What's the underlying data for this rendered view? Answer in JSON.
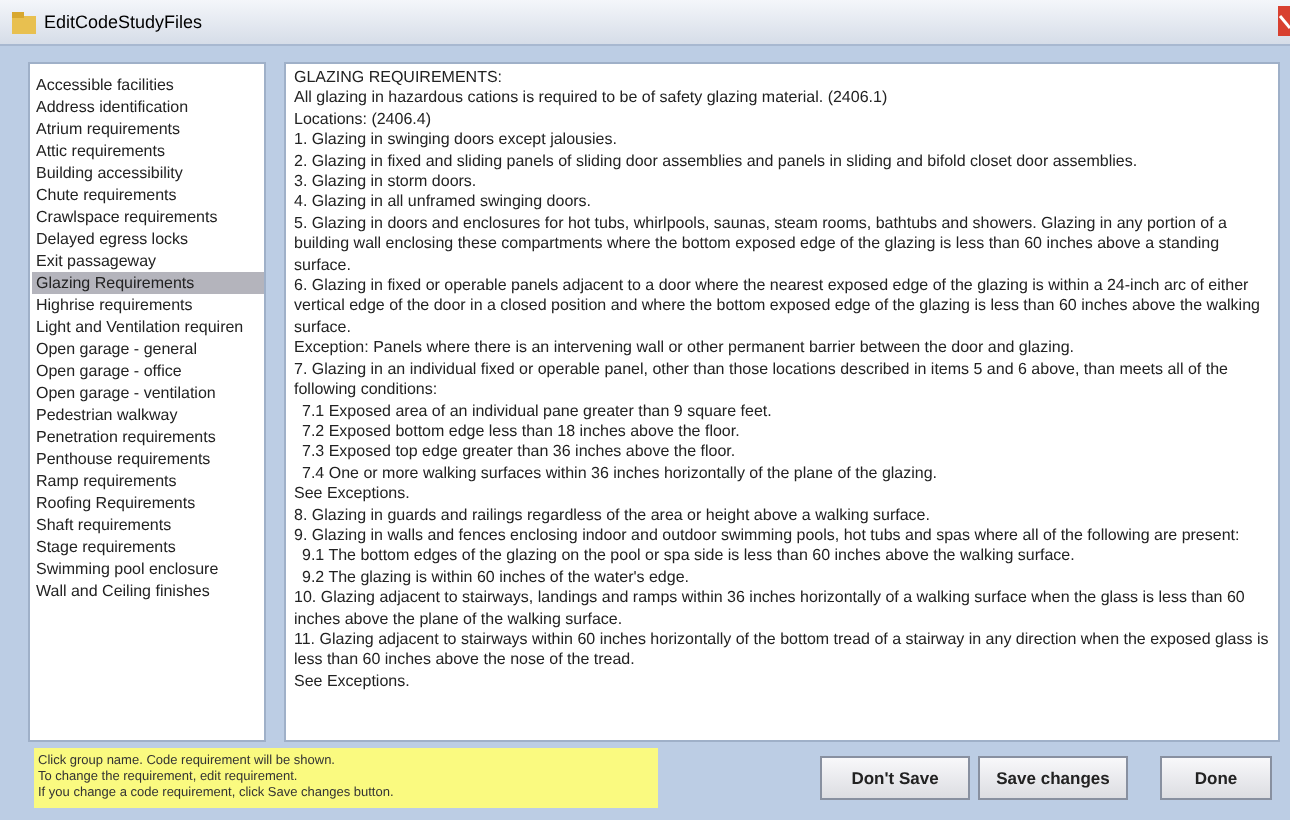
{
  "window": {
    "title": "EditCodeStudyFiles"
  },
  "groups": [
    {
      "label": "Accessible facilities",
      "selected": false
    },
    {
      "label": "Address identification",
      "selected": false
    },
    {
      "label": "Atrium requirements",
      "selected": false
    },
    {
      "label": "Attic requirements",
      "selected": false
    },
    {
      "label": "Building accessibility",
      "selected": false
    },
    {
      "label": "Chute requirements",
      "selected": false
    },
    {
      "label": "Crawlspace requirements",
      "selected": false
    },
    {
      "label": "Delayed egress locks",
      "selected": false
    },
    {
      "label": "Exit passageway",
      "selected": false
    },
    {
      "label": "Glazing Requirements",
      "selected": true
    },
    {
      "label": "Highrise requirements",
      "selected": false
    },
    {
      "label": "Light and Ventilation requiren",
      "selected": false
    },
    {
      "label": "Open garage - general",
      "selected": false
    },
    {
      "label": "Open garage - office",
      "selected": false
    },
    {
      "label": "Open garage - ventilation",
      "selected": false
    },
    {
      "label": "Pedestrian walkway",
      "selected": false
    },
    {
      "label": "Penetration requirements",
      "selected": false
    },
    {
      "label": "Penthouse requirements",
      "selected": false
    },
    {
      "label": "Ramp requirements",
      "selected": false
    },
    {
      "label": "Roofing Requirements",
      "selected": false
    },
    {
      "label": "Shaft requirements",
      "selected": false
    },
    {
      "label": "Stage requirements",
      "selected": false
    },
    {
      "label": "Swimming pool enclosure",
      "selected": false
    },
    {
      "label": "Wall and Ceiling finishes",
      "selected": false
    }
  ],
  "requirement": [
    {
      "kind": "line",
      "text": "GLAZING REQUIREMENTS:"
    },
    {
      "kind": "line",
      "text": "All glazing in hazardous cations is required to be of safety glazing material. (2406.1)"
    },
    {
      "kind": "line",
      "text": "Locations: (2406.4)"
    },
    {
      "kind": "line",
      "text": "1. Glazing in swinging doors except jalousies."
    },
    {
      "kind": "line",
      "text": "2. Glazing in fixed and sliding panels of sliding door assemblies and panels in sliding and bifold closet door assemblies."
    },
    {
      "kind": "line",
      "text": "3. Glazing in storm doors."
    },
    {
      "kind": "line",
      "text": "4. Glazing in all unframed swinging doors."
    },
    {
      "kind": "line",
      "text": "5. Glazing in doors and enclosures for hot tubs, whirlpools, saunas, steam rooms, bathtubs and showers. Glazing in any portion of a building wall enclosing these compartments where the bottom exposed edge of the glazing is less than 60 inches above a standing surface."
    },
    {
      "kind": "line",
      "text": "6. Glazing in fixed or operable panels adjacent to a door where the nearest exposed edge of the glazing is within a 24-inch arc of either vertical edge of the door in a closed position and where the bottom exposed edge of the glazing is less than 60 inches above the walking surface."
    },
    {
      "kind": "line",
      "text": "Exception: Panels where there is an intervening wall or other permanent barrier between the door and glazing."
    },
    {
      "kind": "line",
      "text": "7. Glazing in an individual fixed or operable panel, other than those locations described in items 5 and 6 above, than meets all of the following conditions:"
    },
    {
      "kind": "sub",
      "text": "7.1 Exposed area of an individual pane greater than 9 square feet."
    },
    {
      "kind": "sub",
      "text": "7.2 Exposed bottom edge less than 18 inches above the floor."
    },
    {
      "kind": "sub",
      "text": "7.3 Exposed top edge greater than 36 inches above the floor."
    },
    {
      "kind": "sub",
      "text": "7.4 One or more walking surfaces within 36 inches horizontally of the plane of the glazing."
    },
    {
      "kind": "line",
      "text": "See Exceptions."
    },
    {
      "kind": "line",
      "text": "8. Glazing in guards and railings regardless of the area or height above a walking surface."
    },
    {
      "kind": "line",
      "text": "9. Glazing in walls and fences enclosing indoor and outdoor swimming pools, hot tubs and spas where all of the following are present:"
    },
    {
      "kind": "sub",
      "text": "9.1 The bottom edges of the glazing on the pool or spa side is less than 60 inches above the walking surface."
    },
    {
      "kind": "sub",
      "text": "9.2 The glazing is within 60 inches of the water's edge."
    },
    {
      "kind": "line",
      "text": "10. Glazing adjacent to stairways, landings and ramps within 36 inches horizontally of a walking surface when the glass is less than 60 inches above the plane of the walking surface."
    },
    {
      "kind": "line",
      "text": "11. Glazing adjacent to stairways within 60 inches horizontally of the bottom tread of a stairway in any direction when the exposed glass is less than 60 inches above the nose of the tread."
    },
    {
      "kind": "line",
      "text": "See Exceptions."
    }
  ],
  "help_note": [
    "Click group name. Code requirement will be shown.",
    "To change the requirement, edit requirement.",
    "If you change a code requirement, click Save changes button."
  ],
  "buttons": [
    "Don't Save",
    "Save changes",
    "Done"
  ]
}
